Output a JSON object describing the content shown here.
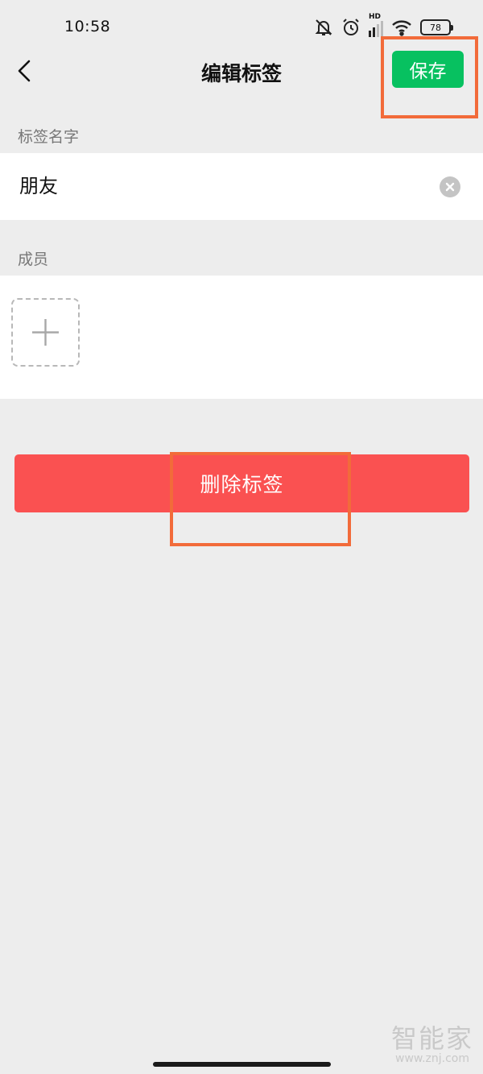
{
  "status_bar": {
    "time": "10:58",
    "network_label": "HD",
    "battery_level": "78",
    "icons": [
      "mute-bell-icon",
      "alarm-icon",
      "signal-icon",
      "wifi-icon",
      "battery-icon"
    ]
  },
  "nav": {
    "title": "编辑标签",
    "save_label": "保存",
    "back_icon": "chevron-left-icon"
  },
  "name_section": {
    "label": "标签名字",
    "value": "朋友"
  },
  "members_section": {
    "label": "成员",
    "add_icon": "plus-icon"
  },
  "delete_label": "删除标签",
  "watermark": {
    "text": "智能家",
    "url": "www.znj.com"
  },
  "colors": {
    "accent_green": "#07c160",
    "danger_red": "#fa5151",
    "page_bg": "#ededed",
    "annotation": "#f26b3a"
  }
}
